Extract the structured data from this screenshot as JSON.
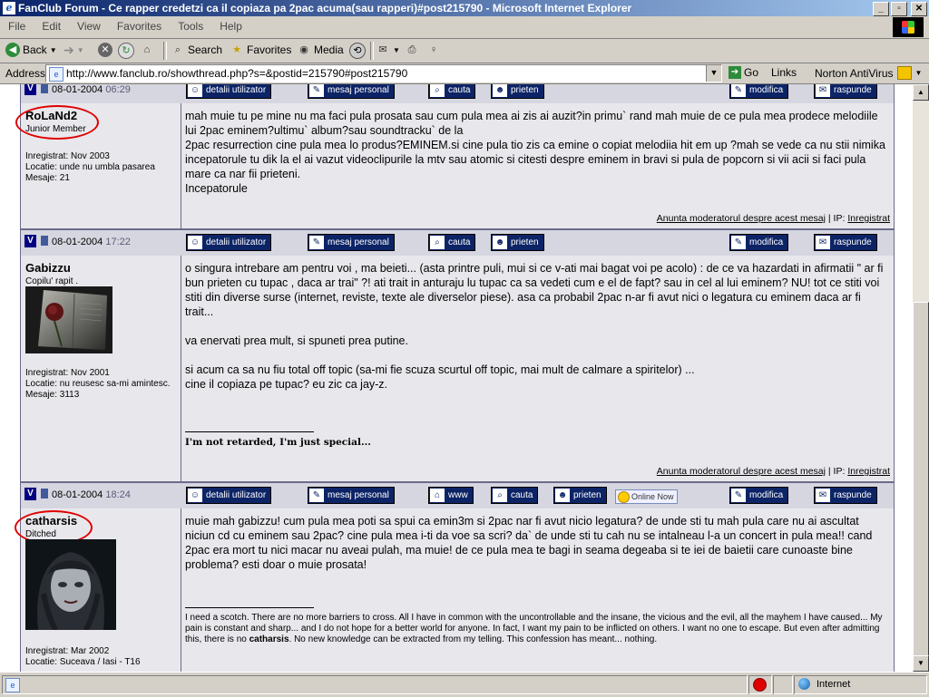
{
  "window": {
    "title": "FanClub Forum - Ce rapper credetzi ca il copiaza pa 2pac acuma(sau rapperi)#post215790 - Microsoft Internet Explorer"
  },
  "menu": [
    "File",
    "Edit",
    "View",
    "Favorites",
    "Tools",
    "Help"
  ],
  "toolbar": {
    "back": "Back",
    "search": "Search",
    "favorites": "Favorites",
    "media": "Media"
  },
  "address": {
    "label": "Address",
    "url": "http://www.fanclub.ro/showthread.php?s=&postid=215790#post215790",
    "go": "Go",
    "links": "Links",
    "norton": "Norton AntiVirus"
  },
  "post_buttons": {
    "profile": "detalii utilizator",
    "pm": "mesaj personal",
    "www": "www",
    "search": "cauta",
    "buddy": "prieten",
    "edit": "modifica",
    "reply": "raspunde",
    "online": "Online Now"
  },
  "report": {
    "link": "Anunta moderatorul despre acest mesaj",
    "ip_label": "| IP:",
    "ip_value": "Inregistrat"
  },
  "posts": [
    {
      "date": "08-01-2004",
      "time": "06:29",
      "username": "RoLaNd2",
      "user_title": "Junior Member",
      "info": "Inregistrat: Nov 2003\nLocatie: unde nu umbla pasarea\nMesaje: 21",
      "message": "mah muie tu pe mine nu ma faci pula prosata sau cum pula mea ai zis ai auzit?in primu` rand mah muie de ce pula mea prodece melodiile lui 2pac eminem?ultimu` album?sau soundtracku` de la\n2pac resurrection cine pula mea lo produs?EMINEM.si cine pula tio zis ca emine o copiat melodiia hit em up ?mah se vede ca nu stii nimika incepatorule tu dik la el ai vazut videoclipurile la mtv sau atomic si citesti despre eminem in bravi si pula de popcorn si vii acii si faci pula mare ca nar fii prieteni.\nIncepatorule"
    },
    {
      "date": "08-01-2004",
      "time": "17:22",
      "username": "Gabizzu",
      "user_title": "Copilu' rapit .",
      "info": "Inregistrat: Nov 2001\nLocatie: nu reusesc sa-mi amintesc.\nMesaje: 3113",
      "message": "o singura intrebare am pentru voi , ma beieti... (asta printre puli, mui si ce v-ati mai bagat voi pe acolo) : de ce va hazardati in afirmatii \" ar fi bun prieten cu tupac , daca ar trai\" ?! ati trait in anturaju lu tupac ca sa vedeti cum e el de fapt? sau in cel al lui eminem? NU! tot ce stiti voi stiti din diverse surse (internet, reviste, texte ale diverselor piese). asa ca probabil 2pac n-ar fi avut nici o legatura cu eminem daca ar fi trait...\n\nva enervati prea mult, si spuneti prea putine.\n\nsi acum ca sa nu fiu total off topic (sa-mi fie scuza scurtul off topic, mai mult de calmare a spiritelor) ...\ncine il copiaza pe tupac? eu zic ca jay-z.",
      "signature": "I'm not retarded, I'm just special..."
    },
    {
      "date": "08-01-2004",
      "time": "18:24",
      "username": "catharsis",
      "user_title": "Ditched",
      "info": "Inregistrat: Mar 2002\nLocatie: Suceava / Iasi - T16",
      "message": "muie mah gabizzu! cum pula mea poti sa spui ca emin3m si 2pac nar fi avut nicio legatura? de unde sti tu mah pula care nu ai ascultat niciun cd cu eminem sau 2pac? cine pula mea i-ti da voe sa scri? da` de unde sti tu cah nu se intalneau l-a un concert in pula mea!! cand 2pac era mort tu nici macar nu aveai pulah, ma muie! de ce pula mea te bagi in seama degeaba si te iei de baietii care cunoaste bine problema? esti doar o muie prosata!",
      "signature_pre": "I need a scotch. There are no more barriers to cross. All I have in common with the uncontrollable and the insane, the vicious and the evil, all the mayhem I have caused... My pain is constant and sharp... and I do not hope for a better world for anyone. In fact, I want my pain to be inflicted on others. I want no one to escape. But even after admitting this, there is no",
      "signature_bold": "catharsis",
      "signature_post": ". No new knowledge can be extracted from my telling. This confession has meant... nothing."
    }
  ],
  "status": {
    "zone": "Internet"
  },
  "colors": {
    "title_bar": "#0a246a",
    "button_bg": "#0c2466",
    "post_bg": "#e8e8ec",
    "highlight_circle": "#e00000"
  }
}
